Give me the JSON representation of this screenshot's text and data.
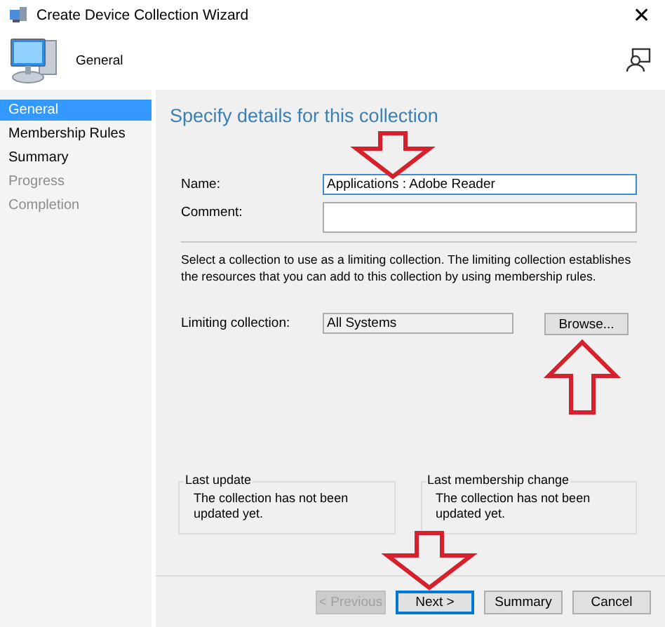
{
  "window": {
    "title": "Create Device Collection Wizard",
    "close": "✕"
  },
  "header": {
    "title": "General"
  },
  "steps": [
    {
      "label": "General",
      "selected": true,
      "disabled": false
    },
    {
      "label": "Membership Rules",
      "selected": false,
      "disabled": false
    },
    {
      "label": "Summary",
      "selected": false,
      "disabled": false
    },
    {
      "label": "Progress",
      "selected": false,
      "disabled": true
    },
    {
      "label": "Completion",
      "selected": false,
      "disabled": true
    }
  ],
  "page": {
    "heading": "Specify details for this collection",
    "name": {
      "label": "Name:",
      "value": "Applications : Adobe Reader"
    },
    "comment": {
      "label": "Comment:"
    },
    "description": "Select a collection to use as a limiting collection. The limiting collection establishes the resources that you can add to this collection by using membership rules.",
    "limiting": {
      "label": "Limiting collection:",
      "value": "All Systems",
      "button": "Browse..."
    },
    "groups": [
      {
        "title": "Last update",
        "text": "The collection has not been updated yet."
      },
      {
        "title": "Last membership change",
        "text": "The collection has not been updated yet."
      }
    ]
  },
  "buttons": [
    {
      "label": "< Previous",
      "disabled": true,
      "default": false
    },
    {
      "label": "Next >",
      "disabled": false,
      "default": true
    },
    {
      "label": "Summary",
      "disabled": false,
      "default": false
    },
    {
      "label": "Cancel",
      "disabled": false,
      "default": false
    }
  ]
}
